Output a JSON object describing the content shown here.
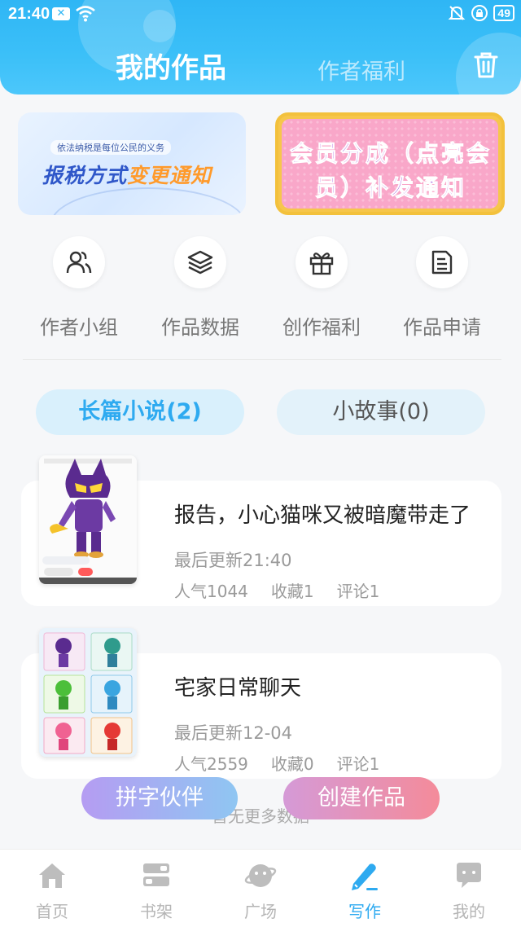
{
  "status": {
    "time": "21:40",
    "battery": "49"
  },
  "header": {
    "tab_mine": "我的作品",
    "tab_welfare": "作者福利"
  },
  "banners": {
    "tax_small": "依法纳税是每位公民的义务",
    "tax_part1": "报税方式",
    "tax_part2": "变更通知",
    "vip_text": "会员分成（点亮会员）补发通知"
  },
  "quick_actions": [
    {
      "label": "作者小组",
      "icon": "group-icon"
    },
    {
      "label": "作品数据",
      "icon": "layers-icon"
    },
    {
      "label": "创作福利",
      "icon": "gift-icon"
    },
    {
      "label": "作品申请",
      "icon": "document-icon"
    }
  ],
  "segments": {
    "long": "长篇小说(2)",
    "short": "小故事(0)"
  },
  "works": [
    {
      "title": "报告，小心猫咪又被暗魔带走了",
      "updated": "最后更新21:40",
      "popularity": "人气1044",
      "favorites": "收藏1",
      "comments": "评论1"
    },
    {
      "title": "宅家日常聊天",
      "updated": "最后更新12-04",
      "popularity": "人气2559",
      "favorites": "收藏0",
      "comments": "评论1"
    }
  ],
  "no_more": "暂无更多数据",
  "fab": {
    "partner": "拼字伙伴",
    "create": "创建作品"
  },
  "nav": [
    {
      "label": "首页",
      "icon": "home-icon"
    },
    {
      "label": "书架",
      "icon": "bookshelf-icon"
    },
    {
      "label": "广场",
      "icon": "planet-icon"
    },
    {
      "label": "写作",
      "icon": "pen-icon"
    },
    {
      "label": "我的",
      "icon": "chat-bubble-icon"
    }
  ],
  "colors": {
    "primary": "#2eaaf0",
    "header": "#3cc0f8",
    "vip_pink": "#f9a7c9",
    "vip_gold": "#f6c64b"
  }
}
